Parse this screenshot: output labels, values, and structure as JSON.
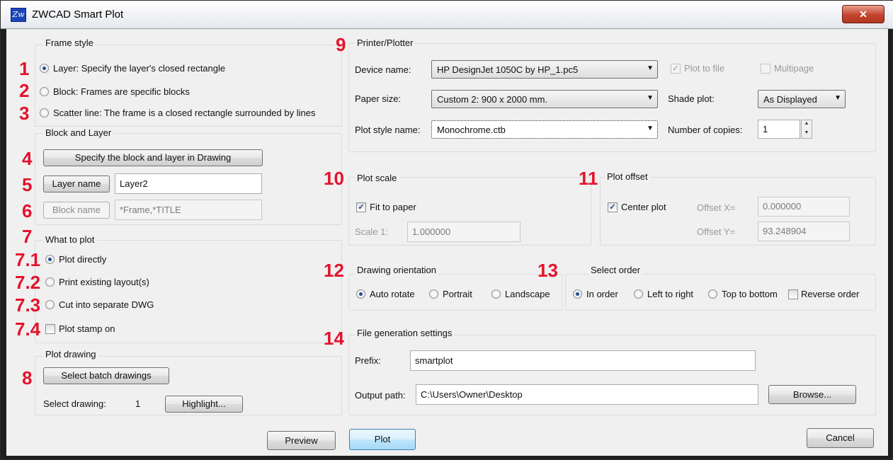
{
  "window": {
    "title": "ZWCAD Smart Plot",
    "close_glyph": "✕"
  },
  "annotations": {
    "n1": "1",
    "n2": "2",
    "n3": "3",
    "n4": "4",
    "n5": "5",
    "n6": "6",
    "n7": "7",
    "n7_1": "7.1",
    "n7_2": "7.2",
    "n7_3": "7.3",
    "n7_4": "7.4",
    "n8": "8",
    "n9": "9",
    "n10": "10",
    "n11": "11",
    "n12": "12",
    "n13": "13",
    "n14": "14"
  },
  "frame_style": {
    "title": "Frame style",
    "options": [
      {
        "label": "Layer: Specify the layer's closed rectangle",
        "selected": true
      },
      {
        "label": "Block: Frames are specific blocks",
        "selected": false
      },
      {
        "label": "Scatter line: The frame is a closed rectangle surrounded by lines",
        "selected": false
      }
    ]
  },
  "block_layer": {
    "title": "Block and Layer",
    "specify_button": "Specify the block and layer in Drawing",
    "layer_button": "Layer name",
    "layer_value": "Layer2",
    "block_button": "Block name",
    "block_value": "*Frame,*TITLE"
  },
  "what_to_plot": {
    "title": "What to plot",
    "options": [
      {
        "label": "Plot directly",
        "selected": true
      },
      {
        "label": "Print existing layout(s)",
        "selected": false
      },
      {
        "label": "Cut into separate DWG",
        "selected": false
      }
    ],
    "stamp_label": "Plot stamp on",
    "stamp_checked": false
  },
  "plot_drawing": {
    "title": "Plot drawing",
    "select_button": "Select batch drawings",
    "select_label": "Select drawing:",
    "count": "1",
    "highlight_button": "Highlight..."
  },
  "printer": {
    "title": "Printer/Plotter",
    "device_label": "Device name:",
    "device_value": "HP DesignJet 1050C by HP_1.pc5",
    "paper_label": "Paper size:",
    "paper_value": "Custom 2: 900 x 2000 mm.",
    "style_label": "Plot style name:",
    "style_value": "Monochrome.ctb",
    "plot_to_file": "Plot to file",
    "multipage": "Multipage",
    "shade_label": "Shade plot:",
    "shade_value": "As Displayed",
    "copies_label": "Number of copies:",
    "copies_value": "1"
  },
  "plot_scale": {
    "title": "Plot scale",
    "fit_label": "Fit to paper",
    "fit_checked": true,
    "scale_label": "Scale 1:",
    "scale_value": "1.000000"
  },
  "plot_offset": {
    "title": "Plot offset",
    "center_label": "Center plot",
    "center_checked": true,
    "x_label": "Offset X=",
    "x_value": "0.000000",
    "y_label": "Offset Y=",
    "y_value": "93.248904"
  },
  "orientation": {
    "title": "Drawing orientation",
    "options": [
      {
        "label": "Auto rotate",
        "selected": true
      },
      {
        "label": "Portrait",
        "selected": false
      },
      {
        "label": "Landscape",
        "selected": false
      }
    ]
  },
  "select_order": {
    "title": "Select order",
    "options": [
      {
        "label": "In order",
        "selected": true
      },
      {
        "label": "Left to right",
        "selected": false
      },
      {
        "label": "Top to bottom",
        "selected": false
      }
    ],
    "reverse_label": "Reverse order",
    "reverse_checked": false
  },
  "file_gen": {
    "title": "File generation settings",
    "prefix_label": "Prefix:",
    "prefix_value": "smartplot",
    "output_label": "Output path:",
    "output_value": "C:\\Users\\Owner\\Desktop",
    "browse_button": "Browse..."
  },
  "footer": {
    "preview": "Preview",
    "plot": "Plot",
    "cancel": "Cancel"
  }
}
